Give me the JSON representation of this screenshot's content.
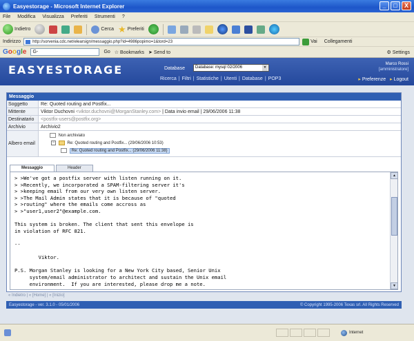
{
  "window": {
    "title": "Easyestorage - Microsoft Internet Explorer",
    "controls": [
      "_",
      "□",
      "X"
    ]
  },
  "menu": [
    "File",
    "Modifica",
    "Visualizza",
    "Preferiti",
    "Strumenti",
    "?"
  ],
  "toolbar": {
    "back": "Indietro",
    "search": "Cerca",
    "favorites": "Preferiti"
  },
  "address": {
    "label": "Indirizzo",
    "url": "http://sorvenia.cdc.net/elearsign/messaggio.php?id=4986popimo=1&tord=23",
    "go": "Vai",
    "links": "Collegamenti"
  },
  "googlebar": {
    "logo": [
      "G",
      "o",
      "o",
      "g",
      "l",
      "e"
    ],
    "go_label": "Go",
    "bookmarks": "Bookmarks",
    "sendto": "Send to",
    "settings": "Settings"
  },
  "app": {
    "logo": "EASYESTORAGE",
    "db_label": "Database",
    "db_value": "Database: mysql 02/2006",
    "nav": [
      "Ricerca",
      "Filtri",
      "Statistiche",
      "Utenti",
      "Database",
      "POP3"
    ],
    "user_name": "Marco Rossi",
    "user_role": "[amministratore]",
    "preferences": "Preferenze",
    "logout": "Logout"
  },
  "message": {
    "panel_title": "Messaggio",
    "labels": {
      "subject": "Soggetto",
      "sender": "Mittente",
      "recipient": "Destinatario",
      "archive": "Archivio",
      "tree": "Albero email"
    },
    "subject": "Re: Quoted routing and Postfix...",
    "sender_name": "Viktor Duchovni",
    "sender_email": "<viktor.duchovni@MorganStanley.com>",
    "date_label": "Data invio email",
    "date_value": "29/06/2006 11:38",
    "recipient": "<postfix-users@postfix.org>",
    "archive": "Archivio2",
    "tree_root": "Non archiviato",
    "tree_item1": "Re: Quoted routing and Postfix... (29/06/2006 10:53)",
    "tree_item2": "Re: Quoted routing and Postfix... (29/06/2006 11:38)",
    "tabs": [
      "Messaggio",
      "Header"
    ],
    "body": [
      "> >We've got a postfix server with listen running on it.",
      "> >Recently, we incorporated a SPAM-filtering server it's",
      "> >keeping email from our very own listen server.",
      "> >The Mail Admin states that it is because of \"quoted",
      "> >routing\" where the emails come accross as",
      "> >\"user1,user2\"@example.com.",
      "",
      "This system is broken. The client that sent this envelope is",
      "in violation of RFC 821.",
      "",
      "--",
      "",
      "        Viktor.",
      "",
      "P.S. Morgan Stanley is looking for a New York City based, Senior Unix",
      "     system/email administrator to architect and sustain the Unix email",
      "     environment.  If you are interested, please drop me a note."
    ]
  },
  "breadcrumbs": "« Indietro | « [Home] | « [Inizio]",
  "footer": {
    "left": "Easyestorage - ver. 3.1.0 - 05/01/2006",
    "right": "© Copyright 1995-2006 Texas srl. All Rights Reserved"
  },
  "statusbar": {
    "zone": "Internet"
  }
}
